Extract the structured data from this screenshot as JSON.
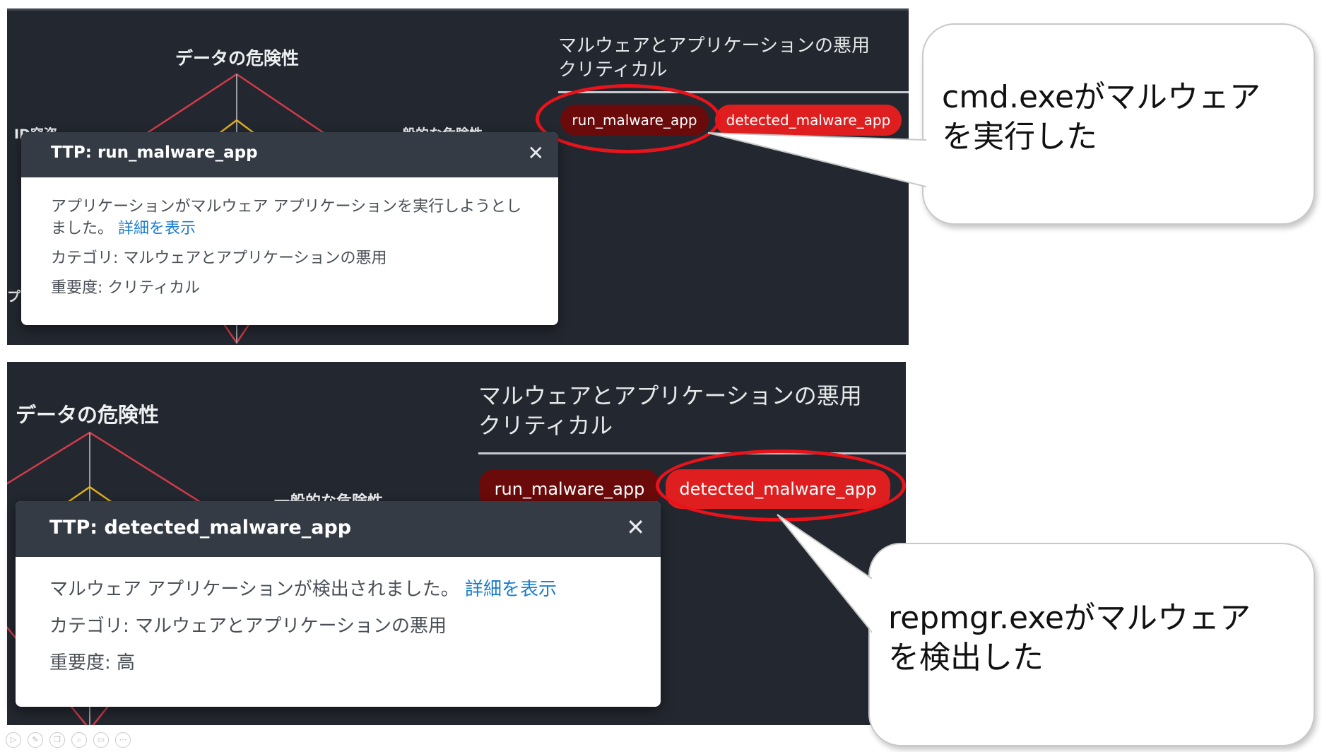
{
  "top_screen": {
    "radar_axis_title": "データの危険性",
    "radar_axis_right": "一般的な危険性",
    "radar_axis_left": "ID窃盗",
    "radar_axis_left_lower": "プ",
    "section_title_line1": "マルウェアとアプリケーションの悪用",
    "section_title_line2": "クリティカル",
    "tags": [
      "run_malware_app",
      "detected_malware_app"
    ],
    "popup": {
      "title": "TTP: run_malware_app",
      "close_glyph": "✕",
      "description": "アプリケーションがマルウェア アプリケーションを実行しようとしました。",
      "link": "詳細を表示",
      "category": "カテゴリ: マルウェアとアプリケーションの悪用",
      "severity": "重要度: クリティカル"
    }
  },
  "bottom_screen": {
    "radar_axis_title": "データの危険性",
    "radar_axis_right": "一般的な危険性",
    "section_title_line1": "マルウェアとアプリケーションの悪用",
    "section_title_line2": "クリティカル",
    "tags": [
      "run_malware_app",
      "detected_malware_app"
    ],
    "popup": {
      "title": "TTP: detected_malware_app",
      "close_glyph": "✕",
      "description": "マルウェア アプリケーションが検出されました。",
      "link": "詳細を表示",
      "category": "カテゴリ: マルウェアとアプリケーションの悪用",
      "severity": "重要度: 高"
    }
  },
  "callouts": [
    {
      "line1": "cmd.exeがマルウェア",
      "line2": "を実行した"
    },
    {
      "line1": "repmgr.exeがマルウェア",
      "line2": "を検出した"
    }
  ],
  "colors": {
    "panel_bg": "#23272f",
    "popup_header": "#353b45",
    "tag_dark": "#6b0a0a",
    "tag_bright": "#df1f1f",
    "highlight_ring": "#e8131b",
    "radar_outer": "#d23b4a",
    "radar_inner": "#e0b020",
    "link": "#1a7dd1"
  },
  "toolbar_icons": [
    "play-icon",
    "pen-icon",
    "copy-icon",
    "zoom-icon",
    "subtitle-icon",
    "more-icon"
  ]
}
